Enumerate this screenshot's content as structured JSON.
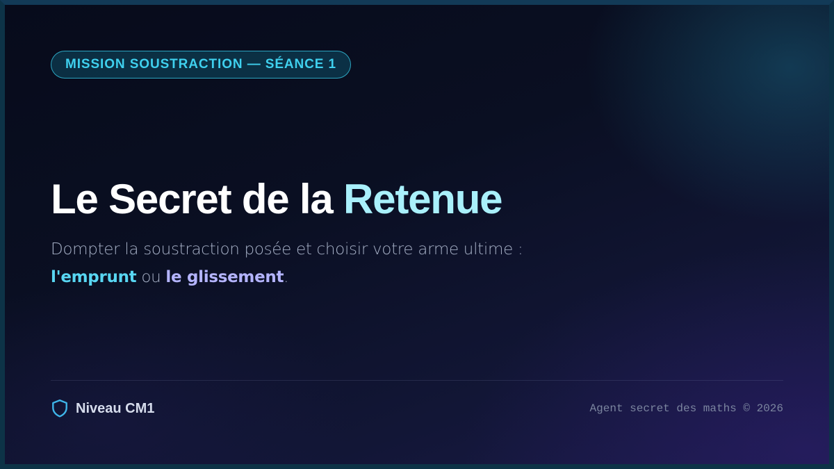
{
  "badge": {
    "label": "MISSION SOUSTRACTION — SÉANCE 1"
  },
  "title": {
    "part1": "Le Secret de la ",
    "part2": "Retenue"
  },
  "subtitle": {
    "line1": "Dompter la soustraction posée et choisir votre arme ultime :",
    "option_a": "l'emprunt",
    "connector": " ou ",
    "option_b": "le glissement",
    "end": "."
  },
  "footer": {
    "level_icon": "shield-icon",
    "level_label": "Niveau CM1",
    "copyright": "Agent secret des maths © 2026"
  },
  "colors": {
    "accent_cyan": "#3fd0ee",
    "title_accent": "#a9f0fb",
    "option_a": "#58d6f2",
    "option_b": "#b4b4ff",
    "background": "#0a0f22"
  }
}
